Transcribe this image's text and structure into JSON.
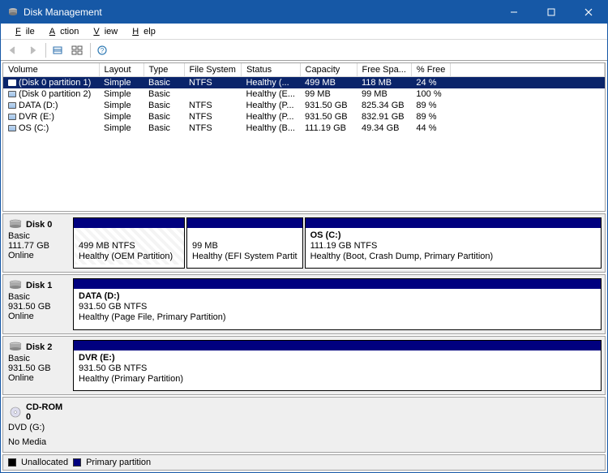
{
  "window": {
    "title": "Disk Management"
  },
  "menu": {
    "file": "File",
    "action": "Action",
    "view": "View",
    "help": "Help"
  },
  "columns": {
    "volume": "Volume",
    "layout": "Layout",
    "type": "Type",
    "filesystem": "File System",
    "status": "Status",
    "capacity": "Capacity",
    "freespace": "Free Spa...",
    "pctfree": "% Free"
  },
  "volumes": [
    {
      "name": "(Disk 0 partition 1)",
      "layout": "Simple",
      "type": "Basic",
      "fs": "NTFS",
      "status": "Healthy (...",
      "cap": "499 MB",
      "free": "118 MB",
      "pct": "24 %",
      "selected": true
    },
    {
      "name": "(Disk 0 partition 2)",
      "layout": "Simple",
      "type": "Basic",
      "fs": "",
      "status": "Healthy (E...",
      "cap": "99 MB",
      "free": "99 MB",
      "pct": "100 %",
      "selected": false
    },
    {
      "name": "DATA (D:)",
      "layout": "Simple",
      "type": "Basic",
      "fs": "NTFS",
      "status": "Healthy (P...",
      "cap": "931.50 GB",
      "free": "825.34 GB",
      "pct": "89 %",
      "selected": false
    },
    {
      "name": "DVR (E:)",
      "layout": "Simple",
      "type": "Basic",
      "fs": "NTFS",
      "status": "Healthy (P...",
      "cap": "931.50 GB",
      "free": "832.91 GB",
      "pct": "89 %",
      "selected": false
    },
    {
      "name": "OS (C:)",
      "layout": "Simple",
      "type": "Basic",
      "fs": "NTFS",
      "status": "Healthy (B...",
      "cap": "111.19 GB",
      "free": "49.34 GB",
      "pct": "44 %",
      "selected": false
    }
  ],
  "disks": {
    "d0": {
      "name": "Disk 0",
      "type": "Basic",
      "size": "111.77 GB",
      "state": "Online",
      "p0": {
        "line1": "499 MB NTFS",
        "line2": "Healthy (OEM Partition)"
      },
      "p1": {
        "line1": "99 MB",
        "line2": "Healthy (EFI System Partit"
      },
      "p2": {
        "title": "OS  (C:)",
        "line1": "111.19 GB NTFS",
        "line2": "Healthy (Boot, Crash Dump, Primary Partition)"
      }
    },
    "d1": {
      "name": "Disk 1",
      "type": "Basic",
      "size": "931.50 GB",
      "state": "Online",
      "p0": {
        "title": "DATA  (D:)",
        "line1": "931.50 GB NTFS",
        "line2": "Healthy (Page File, Primary Partition)"
      }
    },
    "d2": {
      "name": "Disk 2",
      "type": "Basic",
      "size": "931.50 GB",
      "state": "Online",
      "p0": {
        "title": "DVR  (E:)",
        "line1": "931.50 GB NTFS",
        "line2": "Healthy (Primary Partition)"
      }
    },
    "cd": {
      "name": "CD-ROM 0",
      "drive": "DVD (G:)",
      "state": "No Media"
    }
  },
  "legend": {
    "unallocated": "Unallocated",
    "primary": "Primary partition"
  }
}
